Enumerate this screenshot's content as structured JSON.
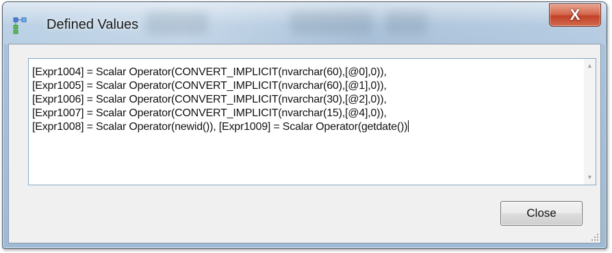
{
  "window": {
    "title": "Defined Values",
    "close_glyph": "X"
  },
  "textbox": {
    "value": "[Expr1004] = Scalar Operator(CONVERT_IMPLICIT(nvarchar(60),[@0],0)),\n[Expr1005] = Scalar Operator(CONVERT_IMPLICIT(nvarchar(60),[@1],0)),\n[Expr1006] = Scalar Operator(CONVERT_IMPLICIT(nvarchar(30),[@2],0)),\n[Expr1007] = Scalar Operator(CONVERT_IMPLICIT(nvarchar(15),[@4],0)),\n[Expr1008] = Scalar Operator(newid()), [Expr1009] = Scalar Operator(getdate())",
    "scroll_up_glyph": "▲",
    "scroll_down_glyph": "▼"
  },
  "buttons": {
    "close_label": "Close"
  },
  "icons": {
    "app_icon": "tree-nodes-icon",
    "resize_grip": "resize-grip-icon"
  },
  "colors": {
    "titlebar": "#b8cfe4",
    "close_button_red": "#c2432a",
    "textbox_border": "#82a7c7",
    "client_background": "#f0f0f0"
  }
}
